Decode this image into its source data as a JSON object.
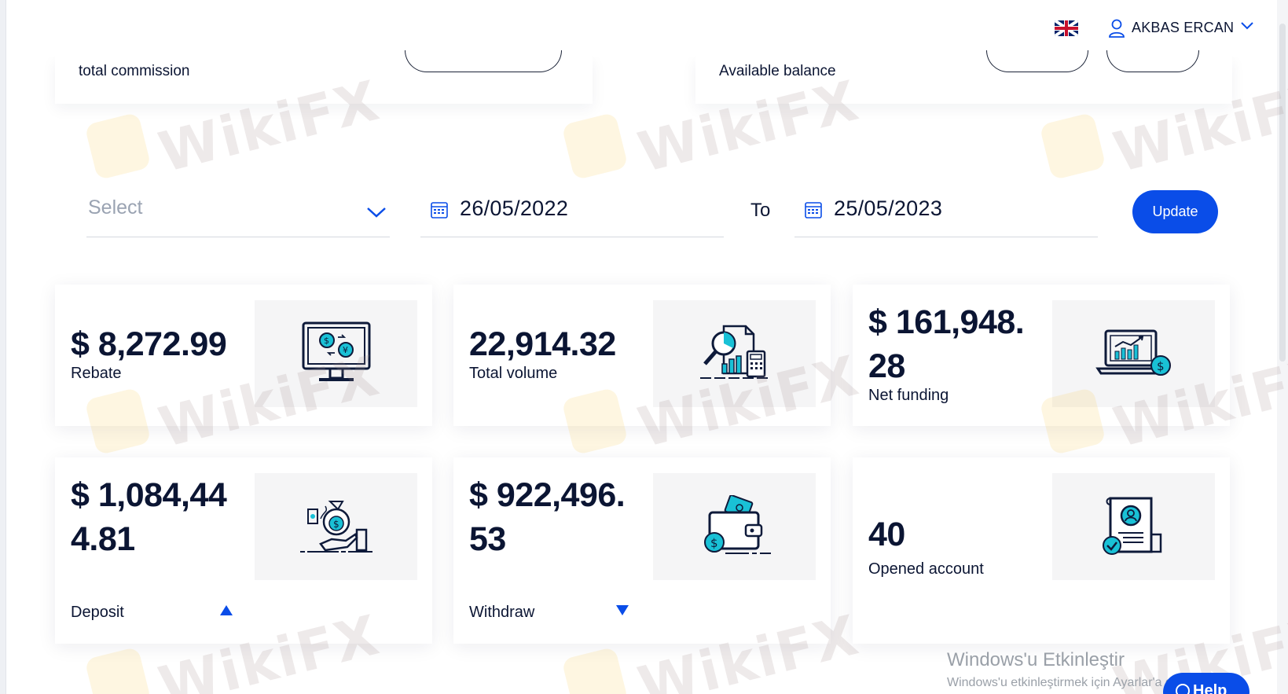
{
  "header": {
    "language_flag": "uk-flag-icon",
    "user_name": "AKBAS ERCAN",
    "user_icon": "user-icon",
    "chevron": "chevron-down-icon"
  },
  "top_cards": {
    "left_label": "total commission",
    "right_label": "Available balance"
  },
  "filters": {
    "select_placeholder": "Select",
    "from_date": "26/05/2022",
    "to_label": "To",
    "to_date": "25/05/2023",
    "update_label": "Update"
  },
  "stats": [
    {
      "value": "$ 8,272.99",
      "label": "Rebate",
      "icon": "monitor-currency-exchange-icon"
    },
    {
      "value": "22,914.32",
      "label": "Total volume",
      "icon": "analytics-report-icon"
    },
    {
      "value": "$ 161,948.28",
      "label": "Net funding",
      "icon": "laptop-chart-dollar-icon"
    },
    {
      "value": "$ 1,084,444.81",
      "label": "Deposit",
      "icon": "hand-money-bag-icon",
      "trend": "up"
    },
    {
      "value": "$ 922,496.53",
      "label": "Withdraw",
      "icon": "wallet-cash-icon",
      "trend": "down"
    },
    {
      "value": "40",
      "label": "Opened account",
      "icon": "certificate-user-icon"
    }
  ],
  "watermark_text": "WikiFX",
  "windows_notice": {
    "title": "Windows'u Etkinleştir",
    "subtitle": "Windows'u etkinleştirmek için Ayarlar'a gidin."
  },
  "help_label": "Help",
  "colors": {
    "primary": "#0a4de8",
    "text": "#0b1533",
    "icon_accent": "#19c1d6",
    "icon_stroke": "#0e1a3a"
  }
}
